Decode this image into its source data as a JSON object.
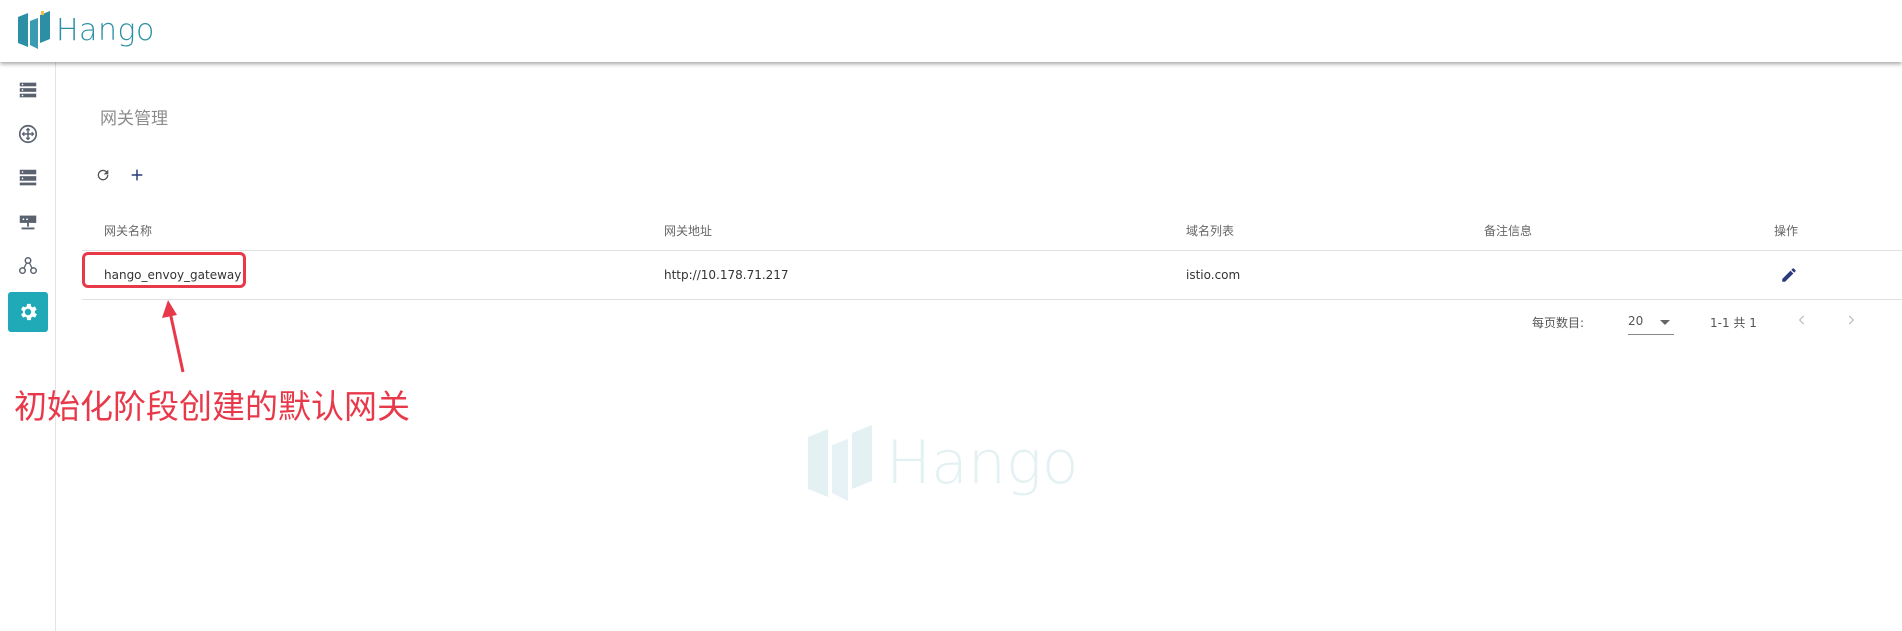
{
  "app": {
    "logo_text": "Hango",
    "brand_color": "#2d8fa3",
    "accent_color": "#20a9b6"
  },
  "sidebar": {
    "items": [
      {
        "icon": "server-list-icon",
        "active": false
      },
      {
        "icon": "router-icon",
        "active": false
      },
      {
        "icon": "server-stack-icon",
        "active": false
      },
      {
        "icon": "network-icon",
        "active": false
      },
      {
        "icon": "graph-nodes-icon",
        "active": false
      },
      {
        "icon": "gear-icon",
        "active": true
      }
    ]
  },
  "page": {
    "title": "网关管理"
  },
  "toolbar": {
    "refresh_icon": "refresh-icon",
    "add_icon": "plus-icon"
  },
  "table": {
    "columns": [
      "网关名称",
      "网关地址",
      "域名列表",
      "备注信息",
      "操作"
    ],
    "rows": [
      {
        "name": "hango_envoy_gateway",
        "address": "http://10.178.71.217",
        "domains": "istio.com",
        "remark": "",
        "action_icon": "edit-icon"
      }
    ]
  },
  "pagination": {
    "label": "每页数目:",
    "page_size": "20",
    "range": "1-1 共 1"
  },
  "annotation": {
    "text": "初始化阶段创建的默认网关",
    "color": "#e8394a"
  },
  "watermark": {
    "text": "Hango"
  }
}
